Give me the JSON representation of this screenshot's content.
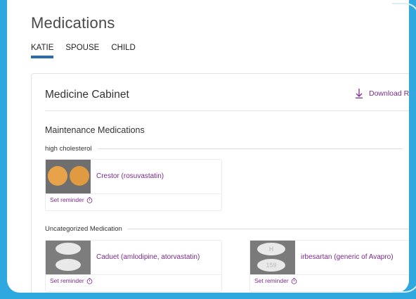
{
  "page": {
    "title": "Medications"
  },
  "tabs": [
    {
      "label": "KATIE"
    },
    {
      "label": "SPOUSE"
    },
    {
      "label": "CHILD"
    }
  ],
  "cabinet": {
    "title": "Medicine Cabinet",
    "download_label": "Download Re"
  },
  "maintenance": {
    "title": "Maintenance Medications",
    "group_label": "high cholesterol",
    "items": [
      {
        "name": "Crestor (rosuvastatin)",
        "reminder": "Set reminder"
      }
    ]
  },
  "uncategorized": {
    "group_label": "Uncategorized Medication",
    "items": [
      {
        "name": "Caduet (amlodipine, atorvastatin)",
        "reminder": "Set reminder"
      },
      {
        "name": "irbesartan (generic of Avapro)",
        "reminder": "Set reminder"
      }
    ]
  },
  "pill_imprints": {
    "caduet": [
      "",
      "",
      ""
    ],
    "irbesartan": [
      "H",
      "159"
    ]
  },
  "colors": {
    "background": "#2fa8e0",
    "accent_link": "#7a2a8a",
    "tab_indicator": "#2b6cb0",
    "crestor_pill": "#e8a24a"
  },
  "icons": {
    "download": "download-arrow-icon",
    "reminder": "clock-icon"
  }
}
